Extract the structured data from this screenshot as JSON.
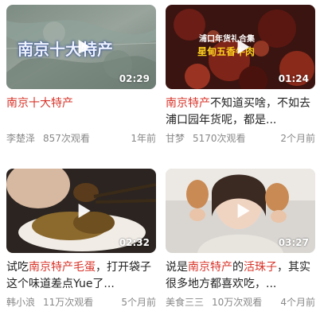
{
  "videos": [
    {
      "thumb_text": "南京十大特产",
      "duration": "02:29",
      "title_segments": [
        {
          "text": "南京十大",
          "highlight": true
        },
        {
          "text": "特产",
          "highlight": true
        }
      ],
      "author": "李楚泽",
      "views": "857次观看",
      "time": "1年前"
    },
    {
      "thumb_text_line1": "浦口年货礼合集",
      "thumb_text_line2": "星甸五香牛肉",
      "duration": "01:24",
      "title_segments": [
        {
          "text": "南京特产",
          "highlight": true
        },
        {
          "text": "不知道买啥，不如去浦口园年货呢，都是...",
          "highlight": false
        }
      ],
      "author": "甘梦",
      "views": "5170次观看",
      "time": "2个月前"
    },
    {
      "duration": "02:32",
      "title_segments": [
        {
          "text": "试吃",
          "highlight": false
        },
        {
          "text": "南京特产毛蛋",
          "highlight": true
        },
        {
          "text": "，打开袋子这个味道差点Yue了...",
          "highlight": false
        }
      ],
      "author": "韩小浪",
      "views": "11万次观看",
      "time": "5个月前"
    },
    {
      "duration": "03:27",
      "title_segments": [
        {
          "text": "说是",
          "highlight": false
        },
        {
          "text": "南京特产",
          "highlight": true
        },
        {
          "text": "的",
          "highlight": false
        },
        {
          "text": "活珠子",
          "highlight": true
        },
        {
          "text": "，其实很多地方都喜欢吃，...",
          "highlight": false
        }
      ],
      "author": "美食三三",
      "views": "10万次观看",
      "time": "4个月前"
    }
  ],
  "icons": {
    "play": "play-icon"
  },
  "colors": {
    "highlight": "#d8342a",
    "meta": "#888888",
    "title": "#222222"
  }
}
